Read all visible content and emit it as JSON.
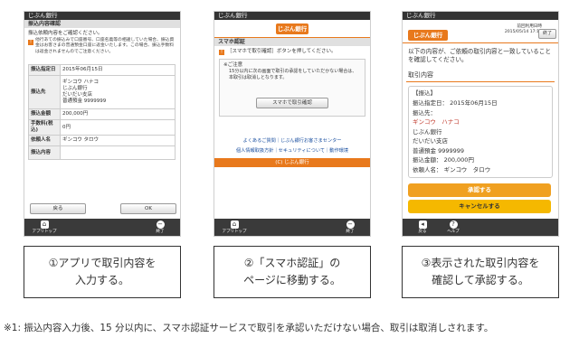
{
  "p1": {
    "status_title": "じぶん銀行",
    "header": "振込内容確認",
    "lead": "振込依頼内容をご確認ください。",
    "notice_badge": "!",
    "notice": "他行あての振込みで口座番号、口座名義等の相違していた場合、振込資金はお客さまの普通預金口座に返金いたします。この場合、振込手数料は返金されませんのでご注意ください。",
    "rows": [
      {
        "key": "振込指定日",
        "value": "2015年06月15日"
      },
      {
        "key": "振込先",
        "value": "ギンコウ ハナコ\nじぶん銀行\nだいだい支店\n普通預金 9999999"
      },
      {
        "key": "振込金額",
        "value": "200,000円"
      },
      {
        "key": "手数料(税込)",
        "value": "0円"
      },
      {
        "key": "依頼人名",
        "value": "ギンコウ タロウ"
      },
      {
        "key": "振込内容",
        "value": ""
      }
    ],
    "btn_back": "戻る",
    "btn_ok": "OK",
    "foot_left": "アプリトップ",
    "foot_right": "終了"
  },
  "p2": {
    "status_title": "じぶん銀行",
    "logo": "じぶん銀行",
    "header": "スマホ認証",
    "lead_badge": "!",
    "lead": "［スマホで取引確認］ボタンを押してください。",
    "notice_title": "※ご注意",
    "notice": "15分以内に次の画面で取引の承認をしていただかない場合は、本取引は取消しとなります。",
    "confirm_btn": "スマホで取引確認",
    "faq": "よくあるご質問｜じぶん銀行お客さまセンター",
    "links": "個人情報取扱方針｜セキュリティについて｜動作環境",
    "copyright": "(C) じぶん銀行",
    "foot_left": "アプリトップ",
    "foot_right": "終了"
  },
  "p3": {
    "status_title": "じぶん銀行",
    "logo": "じぶん銀行",
    "last_login": "前回利用日時\n2015/05/14 17:12",
    "end_btn": "終了",
    "lead": "以下の内容が、ご依頼の取引内容と一致していることを確認してください。",
    "section": "取引内容",
    "box_title": "【振込】",
    "lines": [
      "振込指定日：  2015年06月15日",
      "振込先：",
      "ギンコウ　ハナコ",
      "じぶん銀行",
      "だいだい支店",
      "普通預金 9999999",
      "振込金額：  200,000円",
      "依頼人名：  ギンコウ　タロウ"
    ],
    "approve": "承認する",
    "cancel": "キャンセルする",
    "foot_left": "戻る",
    "foot_right": "ヘルプ"
  },
  "captions": [
    [
      "①アプリで取引内容を",
      "入力する。"
    ],
    [
      "②「スマホ認証」の",
      "ページに移動する。"
    ],
    [
      "③表示された取引内容を",
      "確認して承認する。"
    ]
  ],
  "footnote": "※1: 振込内容入力後、15 分以内に、スマホ認証サービスで取引を承認いただけない場合、取引は取消しされます。",
  "colors": {
    "orange": "#e8791c",
    "approve": "#f0a020",
    "cancel": "#f5b800"
  }
}
